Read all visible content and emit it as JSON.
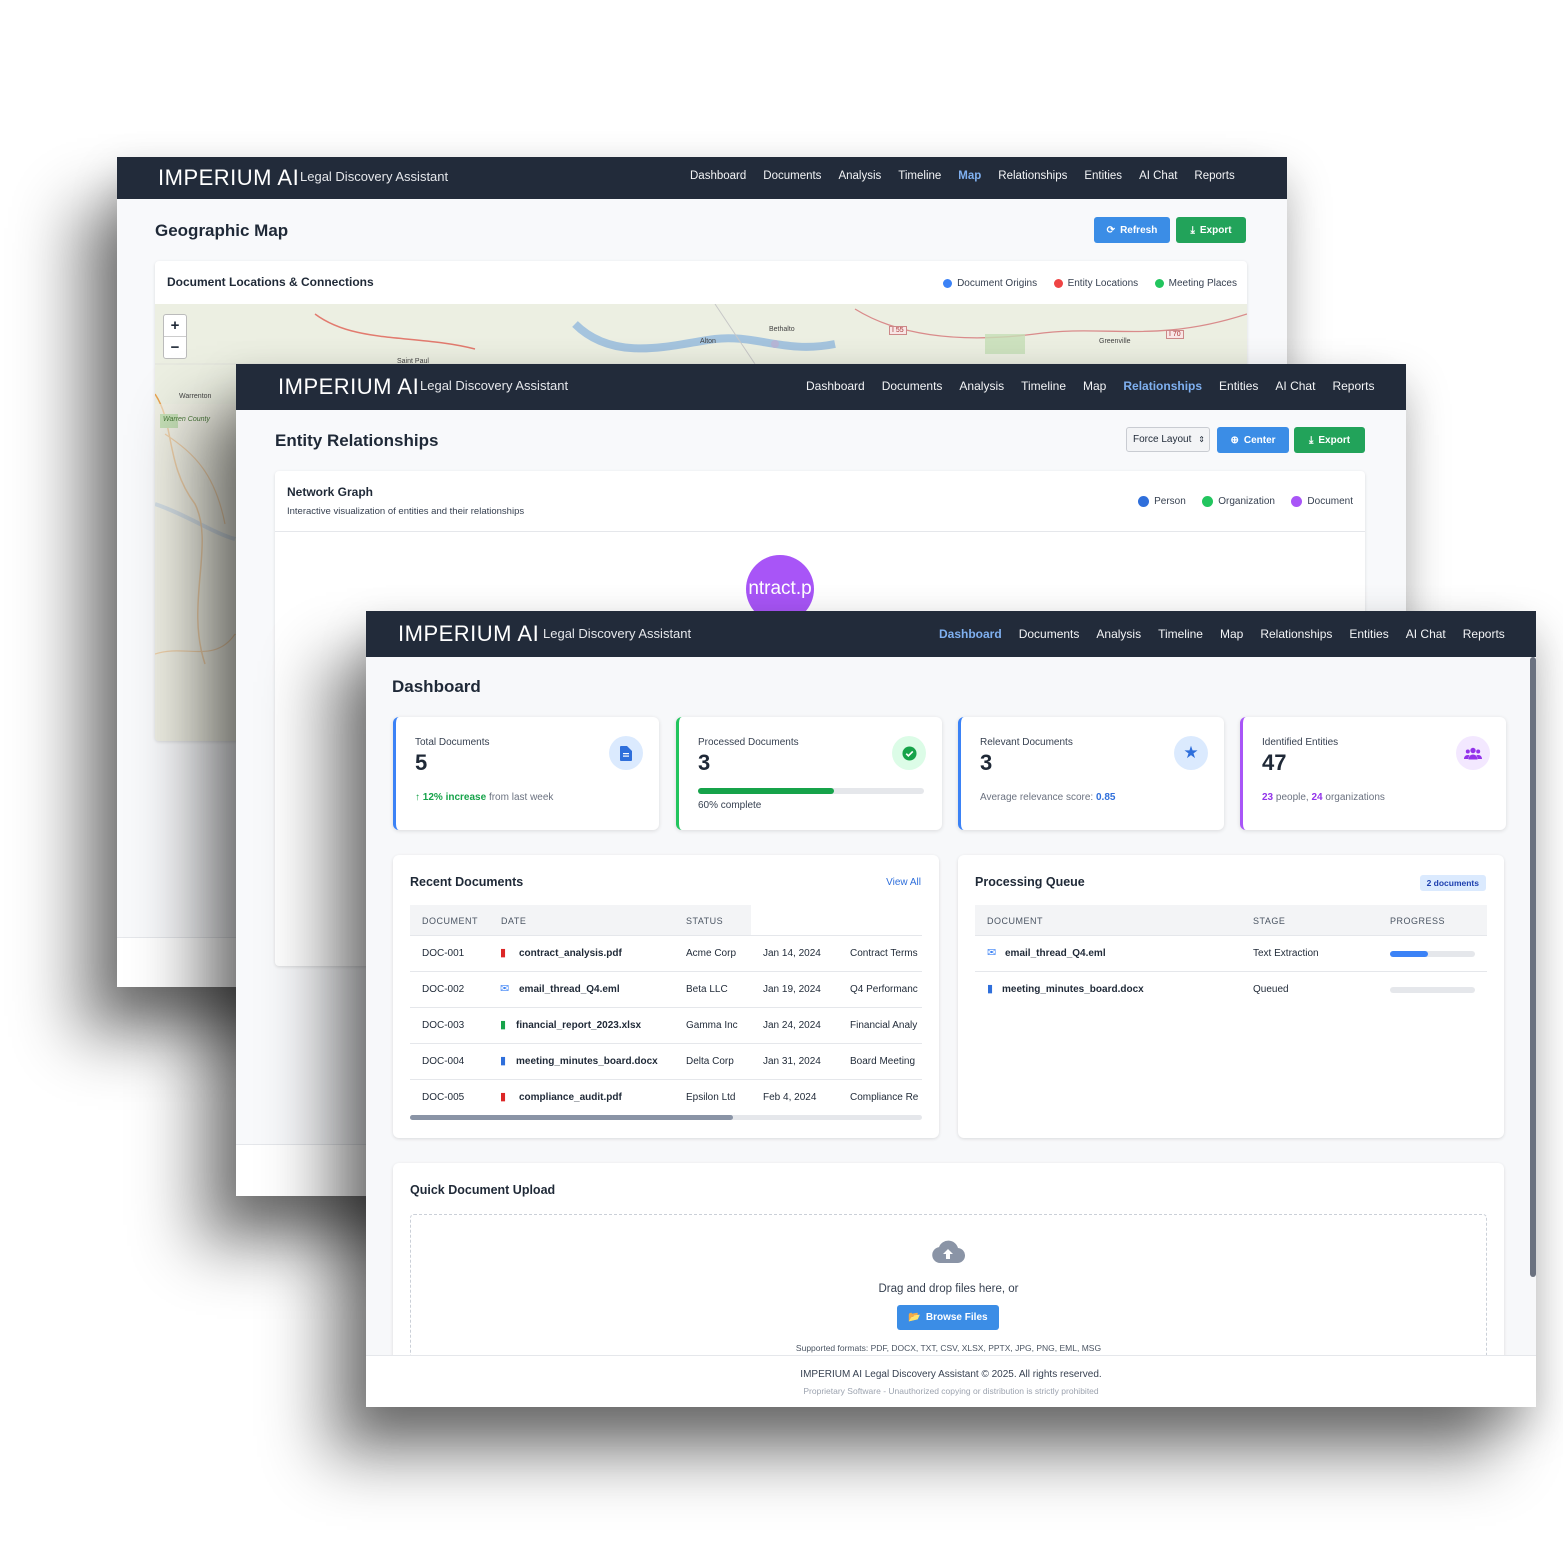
{
  "app": {
    "logo": "IMPERIUM AI",
    "subtitle": "Legal Discovery Assistant"
  },
  "nav": [
    "Dashboard",
    "Documents",
    "Analysis",
    "Timeline",
    "Map",
    "Relationships",
    "Entities",
    "AI Chat",
    "Reports"
  ],
  "map_window": {
    "title": "Geographic Map",
    "refresh_label": "Refresh",
    "export_label": "Export",
    "card_title": "Document Locations & Connections",
    "legend": [
      "Document Origins",
      "Entity Locations",
      "Meeting Places"
    ],
    "zoom_in": "+",
    "zoom_out": "−",
    "map_labels": [
      "Bethalto",
      "Alton",
      "Greenville",
      "I 55",
      "I 70",
      "Saint Paul",
      "Warrenton",
      "Warren County"
    ]
  },
  "relationships_window": {
    "title": "Entity Relationships",
    "layout_select": "Force Layout",
    "center_label": "Center",
    "export_label": "Export",
    "card_title": "Network Graph",
    "card_subtitle": "Interactive visualization of entities and their relationships",
    "legend": [
      "Person",
      "Organization",
      "Document"
    ],
    "node_label": "ntract.p"
  },
  "dashboard": {
    "title": "Dashboard",
    "stats": {
      "total": {
        "label": "Total Documents",
        "value": "5",
        "trend": "12% increase",
        "trend_suffix": "from last week"
      },
      "processed": {
        "label": "Processed Documents",
        "value": "3",
        "progress": 0.6,
        "progress_text": "60% complete"
      },
      "relevant": {
        "label": "Relevant Documents",
        "value": "3",
        "note": "Average relevance score:",
        "score": "0.85"
      },
      "entities": {
        "label": "Identified Entities",
        "value": "47",
        "people": "23",
        "people_label": "people,",
        "orgs": "24",
        "orgs_label": "organizations"
      }
    },
    "recent": {
      "title": "Recent Documents",
      "view_all": "View All",
      "headers": [
        "DOCUMENT",
        "DATE",
        "STATUS"
      ],
      "rows": [
        {
          "id": "DOC-001",
          "name": "contract_analysis.pdf",
          "org": "Acme Corp",
          "date": "Jan 14, 2024",
          "topic": "Contract Terms",
          "icon": "pdf-icon"
        },
        {
          "id": "DOC-002",
          "name": "email_thread_Q4.eml",
          "org": "Beta LLC",
          "date": "Jan 19, 2024",
          "topic": "Q4 Performanc",
          "icon": "email-icon"
        },
        {
          "id": "DOC-003",
          "name": "financial_report_2023.xlsx",
          "org": "Gamma Inc",
          "date": "Jan 24, 2024",
          "topic": "Financial Analy",
          "icon": "excel-icon"
        },
        {
          "id": "DOC-004",
          "name": "meeting_minutes_board.docx",
          "org": "Delta Corp",
          "date": "Jan 31, 2024",
          "topic": "Board Meeting",
          "icon": "word-icon"
        },
        {
          "id": "DOC-005",
          "name": "compliance_audit.pdf",
          "org": "Epsilon Ltd",
          "date": "Feb 4, 2024",
          "topic": "Compliance Re",
          "icon": "pdf-icon"
        }
      ]
    },
    "queue": {
      "title": "Processing Queue",
      "badge": "2 documents",
      "headers": [
        "DOCUMENT",
        "STAGE",
        "PROGRESS"
      ],
      "rows": [
        {
          "name": "email_thread_Q4.eml",
          "stage": "Text Extraction",
          "progress": 0.45,
          "icon": "email-icon"
        },
        {
          "name": "meeting_minutes_board.docx",
          "stage": "Queued",
          "progress": 0,
          "icon": "word-icon"
        }
      ]
    },
    "upload": {
      "title": "Quick Document Upload",
      "drop_text": "Drag and drop files here, or",
      "browse_label": "Browse Files",
      "formats": "Supported formats: PDF, DOCX, TXT, CSV, XLSX, PPTX, JPG, PNG, EML, MSG"
    },
    "footer": {
      "line1": "IMPERIUM AI Legal Discovery Assistant © 2025. All rights reserved.",
      "line2": "Proprietary Software - Unauthorized copying or distribution is strictly prohibited"
    }
  },
  "colors": {
    "nav_bg": "#222b3a",
    "accent_blue": "#3b8de6",
    "accent_green": "#22a35a",
    "person": "#2f6fdb",
    "organization": "#22c55e",
    "document": "#a855f7",
    "origins": "#3b82f6",
    "entity_locations": "#ef4444",
    "meeting_places": "#22c55e"
  }
}
